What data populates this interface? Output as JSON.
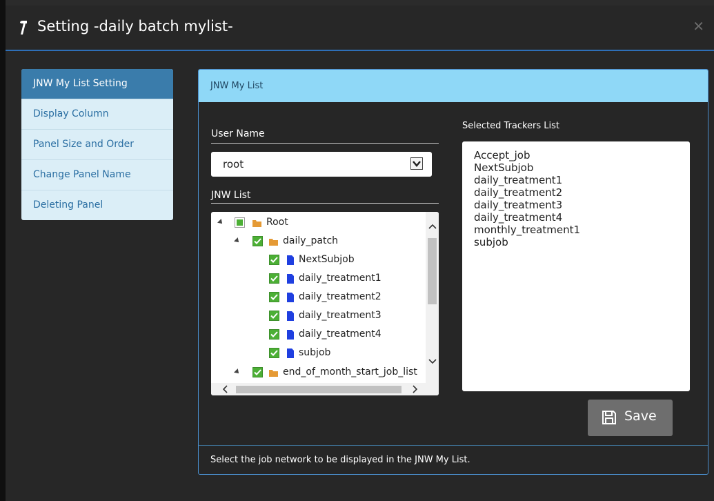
{
  "window": {
    "title": "Setting -daily batch mylist-",
    "close_icon": "close-icon"
  },
  "menu": {
    "items": [
      {
        "label": "JNW My List Setting",
        "active": true
      },
      {
        "label": "Display Column"
      },
      {
        "label": "Panel Size and Order"
      },
      {
        "label": "Change Panel Name"
      },
      {
        "label": "Deleting Panel"
      }
    ]
  },
  "panel": {
    "title": "JNW My List",
    "user_name_label": "User Name",
    "user_name_value": "root",
    "jnw_list_label": "JNW List",
    "selected_label": "Selected Trackers List",
    "footer": "Select the job network to be displayed in the JNW My List."
  },
  "tree": {
    "nodes": [
      {
        "label": "Root",
        "type": "folder",
        "level": 0,
        "checked": "partial"
      },
      {
        "label": "daily_patch",
        "type": "folder",
        "level": 1,
        "checked": "true"
      },
      {
        "label": "NextSubjob",
        "type": "file",
        "level": 2,
        "checked": "true"
      },
      {
        "label": "daily_treatment1",
        "type": "file",
        "level": 2,
        "checked": "true"
      },
      {
        "label": "daily_treatment2",
        "type": "file",
        "level": 2,
        "checked": "true"
      },
      {
        "label": "daily_treatment3",
        "type": "file",
        "level": 2,
        "checked": "true"
      },
      {
        "label": "daily_treatment4",
        "type": "file",
        "level": 2,
        "checked": "true"
      },
      {
        "label": "subjob",
        "type": "file",
        "level": 2,
        "checked": "true"
      },
      {
        "label": "end_of_month_start_job_list",
        "type": "folder",
        "level": 1,
        "checked": "true"
      }
    ]
  },
  "trackers": [
    "Accept_job",
    "NextSubjob",
    "daily_treatment1",
    "daily_treatment2",
    "daily_treatment3",
    "daily_treatment4",
    "monthly_treatment1",
    "subjob"
  ],
  "save_button": {
    "label": "Save",
    "icon": "floppy-disk-icon"
  },
  "colors": {
    "accent": "#2e6fb8",
    "menu_active": "#3a7cab",
    "panel_header": "#8fd8f7",
    "check_green": "#4caf35",
    "doc_blue": "#1f3fe0",
    "folder_orange": "#e59a35"
  }
}
